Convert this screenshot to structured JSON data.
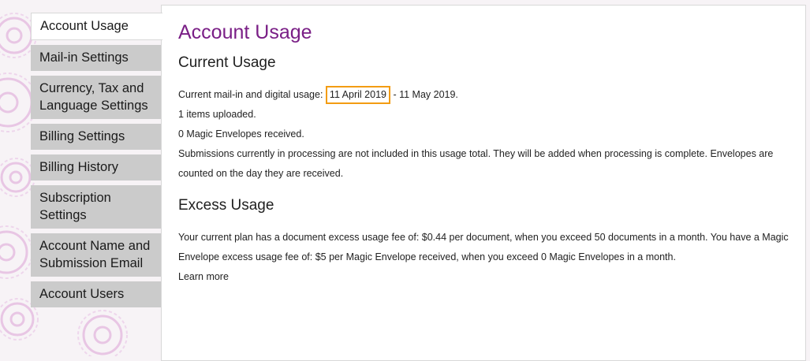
{
  "sidebar": {
    "items": [
      {
        "label": "Account Usage",
        "active": true
      },
      {
        "label": "Mail-in Settings"
      },
      {
        "label": "Currency, Tax and Language Settings"
      },
      {
        "label": "Billing Settings"
      },
      {
        "label": "Billing History"
      },
      {
        "label": "Subscription Settings"
      },
      {
        "label": "Account Name and Submission Email"
      },
      {
        "label": "Account Users"
      }
    ]
  },
  "main": {
    "title": "Account Usage",
    "current": {
      "heading": "Current Usage",
      "period_prefix": "Current mail-in and digital usage:",
      "period_start": "11 April 2019",
      "period_end": " - 11 May 2019.",
      "items_uploaded": "1 items uploaded.",
      "envelopes_received": "0 Magic Envelopes received.",
      "note_line1": "Submissions currently in processing are not included in this usage total. They will be added when processing is complete. Envelopes are",
      "note_line2": "counted on the day they are received."
    },
    "excess": {
      "heading": "Excess Usage",
      "line1": "Your current plan has a document excess usage fee of: $0.44 per document, when you exceed 50 documents in a month. You have a Magic",
      "line2": "Envelope excess usage fee of: $5 per Magic Envelope received, when you exceed 0 Magic Envelopes in a month.",
      "learn_more": "Learn more"
    }
  },
  "colors": {
    "title": "#7a1f86",
    "highlight_border": "#f39c12",
    "nav_bg": "#cbcbcb",
    "background_pattern": "#e9c8e6"
  }
}
